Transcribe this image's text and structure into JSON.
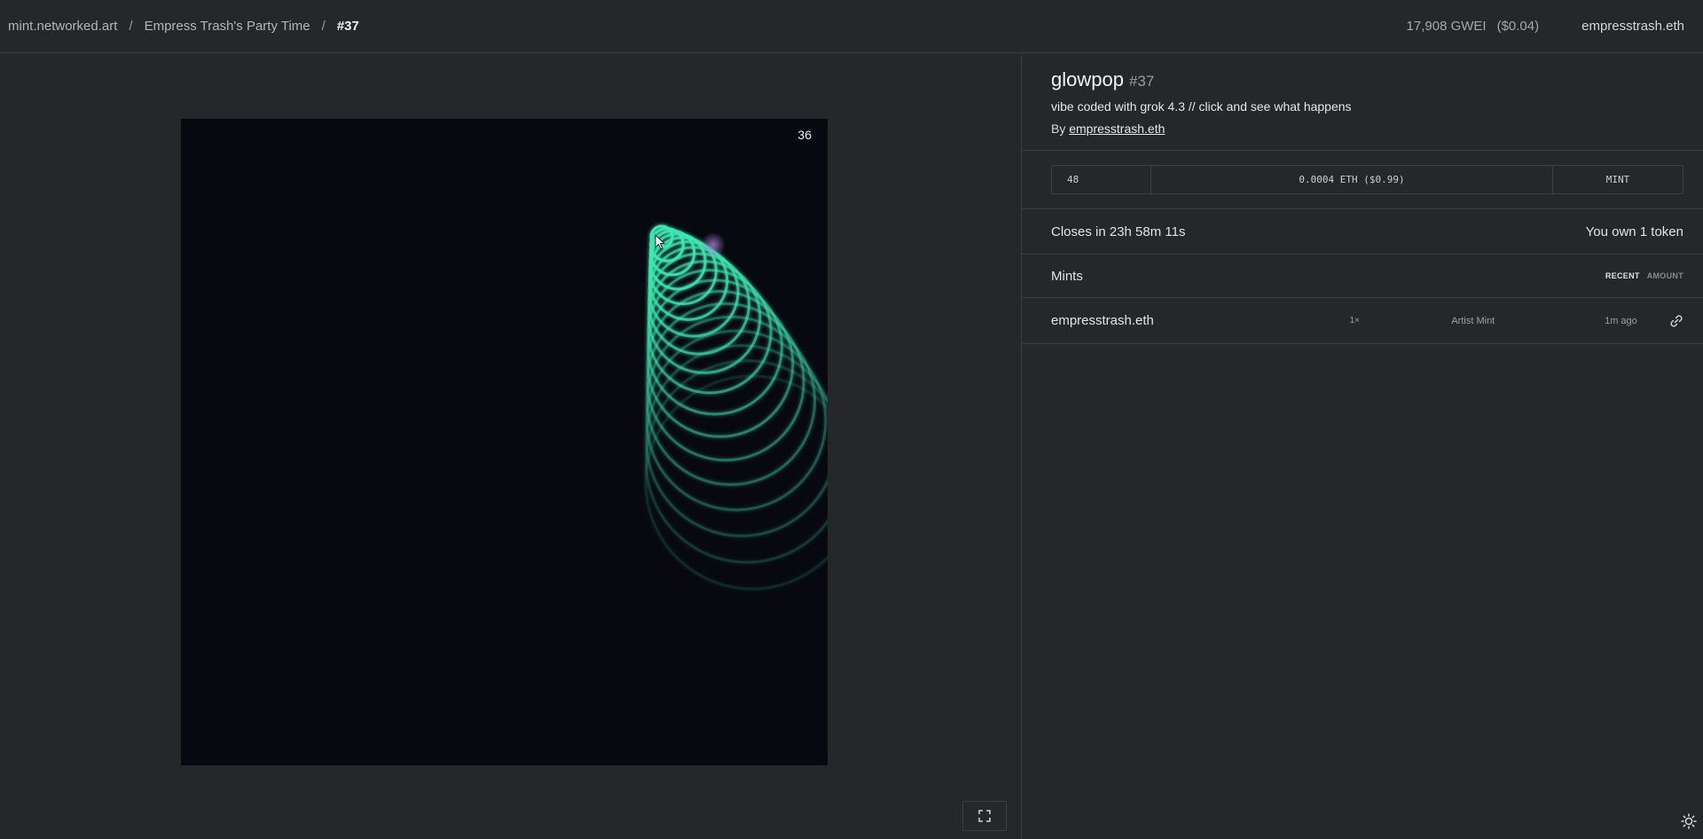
{
  "breadcrumb": {
    "site": "mint.networked.art",
    "separator": "/",
    "collection": "Empress Trash's Party Time",
    "token": "#37"
  },
  "header": {
    "gas": "17,908 GWEI",
    "gas_usd": "($0.04)",
    "account": "empresstrash.eth"
  },
  "artwork": {
    "counter": "36",
    "ring_color": "#3ee8b0",
    "background": "#080811"
  },
  "token": {
    "title": "glowpop",
    "number": "#37",
    "description": "vibe coded with grok 4.3 // click and see what happens",
    "by_prefix": "By",
    "artist": "empresstrash.eth"
  },
  "mint": {
    "quantity": "48",
    "price": "0.0004 ETH ($0.99)",
    "button": "MINT"
  },
  "status": {
    "closes": "Closes in 23h 58m 11s",
    "owned": "You own 1 token"
  },
  "mints": {
    "heading": "Mints",
    "tabs": {
      "recent": "RECENT",
      "amount": "AMOUNT"
    },
    "items": [
      {
        "minter": "empresstrash.eth",
        "amount": "1×",
        "kind": "Artist Mint",
        "when": "1m ago"
      }
    ]
  },
  "icons": {
    "fullscreen": "fullscreen-icon",
    "link": "link-icon",
    "theme": "sun-icon",
    "cursor": "pointer-cursor-icon"
  }
}
